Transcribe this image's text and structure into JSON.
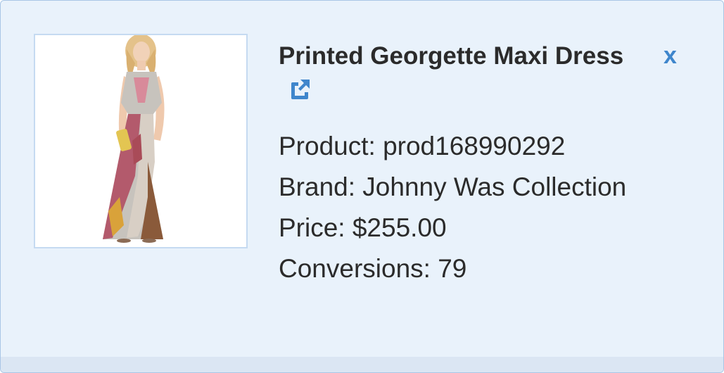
{
  "product": {
    "title": "Printed Georgette Maxi Dress",
    "product_label": "Product: prod168990292",
    "brand_label": "Brand: Johnny Was Collection",
    "price_label": "Price: $255.00",
    "conversions_label": "Conversions: 79",
    "image_icon": "dress-product-photo"
  },
  "actions": {
    "close_label": "x",
    "external_link_icon": "external-link-icon"
  },
  "colors": {
    "accent": "#3f86cc",
    "panel_bg": "#e9f2fb",
    "panel_border": "#a9c6e6"
  }
}
